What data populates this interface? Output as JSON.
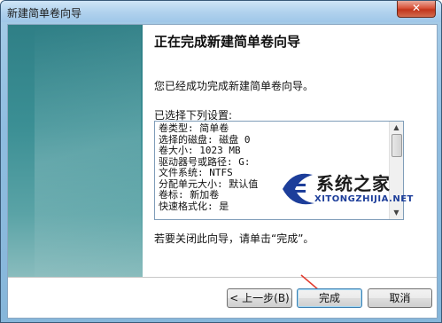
{
  "window": {
    "title": "新建简单卷向导",
    "close_label": "✕"
  },
  "wizard": {
    "heading": "正在完成新建简单卷向导",
    "completed_text": "您已经成功完成新建简单卷向导。",
    "settings_label": "已选择下列设置:",
    "settings": [
      "卷类型: 简单卷",
      "选择的磁盘: 磁盘 0",
      "卷大小: 1023 MB",
      "驱动器号或路径: G:",
      "文件系统: NTFS",
      "分配单元大小: 默认值",
      "卷标: 新加卷",
      "快速格式化: 是"
    ],
    "close_instruction": "若要关闭此向导，请单击“完成”。"
  },
  "buttons": {
    "back": "< 上一步(B)",
    "finish": "完成",
    "cancel": "取消"
  },
  "watermark": {
    "text": "系统之家",
    "sub": "XITONGZHIJIA.NET"
  },
  "colors": {
    "side_panel": "#3b8f94",
    "arrow": "#e23b2e",
    "watermark_blue": "#1d3e9a"
  }
}
